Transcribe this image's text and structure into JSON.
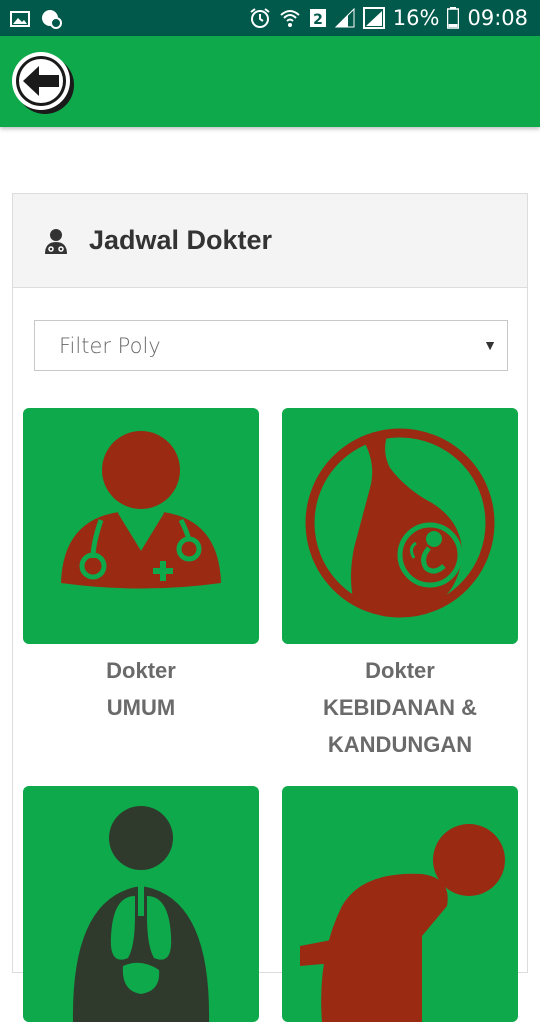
{
  "status_bar": {
    "battery": "16%",
    "time": "09:08",
    "sim_badge": "2",
    "icons": [
      "image-icon",
      "whatsapp-icon",
      "alarm-icon",
      "wifi-icon",
      "sim2-icon",
      "signal-icon",
      "signal-icon",
      "battery-icon"
    ]
  },
  "app_bar": {
    "back_icon": "back-arrow-icon",
    "accent": "#0ea94a"
  },
  "card": {
    "title": "Jadwal Dokter",
    "icon": "doctor-icon"
  },
  "filter": {
    "placeholder": "Filter Poly"
  },
  "tiles": [
    {
      "line1": "Dokter",
      "line2": "UMUM",
      "line3": "",
      "icon": "general-doctor-icon"
    },
    {
      "line1": "Dokter",
      "line2": "KEBIDANAN &",
      "line3": "KANDUNGAN",
      "icon": "pregnancy-icon"
    },
    {
      "line1": "",
      "line2": "",
      "line3": "",
      "icon": "lungs-internal-medicine-icon"
    },
    {
      "line1": "",
      "line2": "",
      "line3": "",
      "icon": "crawling-baby-icon"
    }
  ],
  "colors": {
    "status_bar": "#00594a",
    "green": "#0ea94a",
    "icon_red": "#9a2a12",
    "label_gray": "#6a6a6a"
  }
}
